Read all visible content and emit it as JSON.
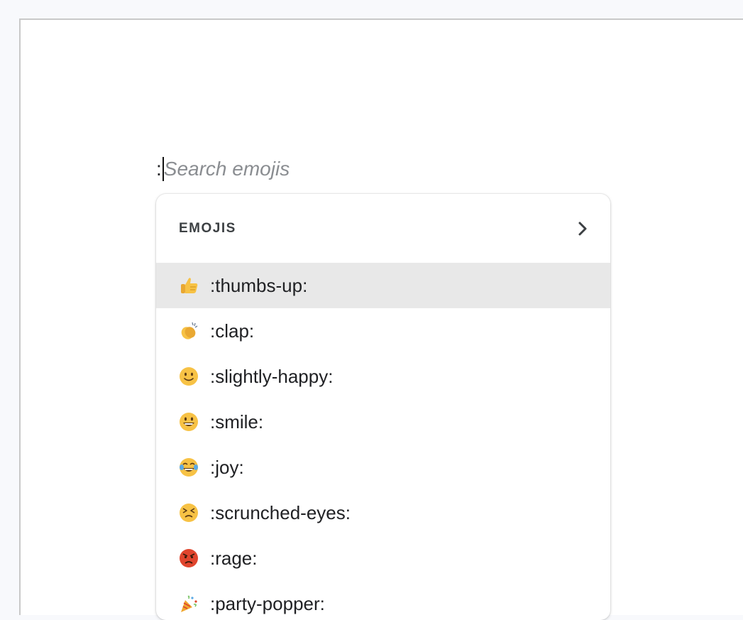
{
  "search": {
    "prefix": ":",
    "placeholder": "Search emojis"
  },
  "menu": {
    "title": "EMOJIS",
    "items": [
      {
        "label": ":thumbs-up:",
        "icon": "thumbs-up-icon",
        "active": true
      },
      {
        "label": ":clap:",
        "icon": "clap-icon",
        "active": false
      },
      {
        "label": ":slightly-happy:",
        "icon": "slightly-happy-icon",
        "active": false
      },
      {
        "label": ":smile:",
        "icon": "smile-icon",
        "active": false
      },
      {
        "label": ":joy:",
        "icon": "joy-icon",
        "active": false
      },
      {
        "label": ":scrunched-eyes:",
        "icon": "scrunched-eyes-icon",
        "active": false
      },
      {
        "label": ":rage:",
        "icon": "rage-icon",
        "active": false
      },
      {
        "label": ":party-popper:",
        "icon": "party-popper-icon",
        "active": false
      }
    ]
  },
  "colors": {
    "highlight": "#e8e8e8",
    "emoji_yellow": "#f7c245",
    "rage_red": "#e0452d"
  }
}
